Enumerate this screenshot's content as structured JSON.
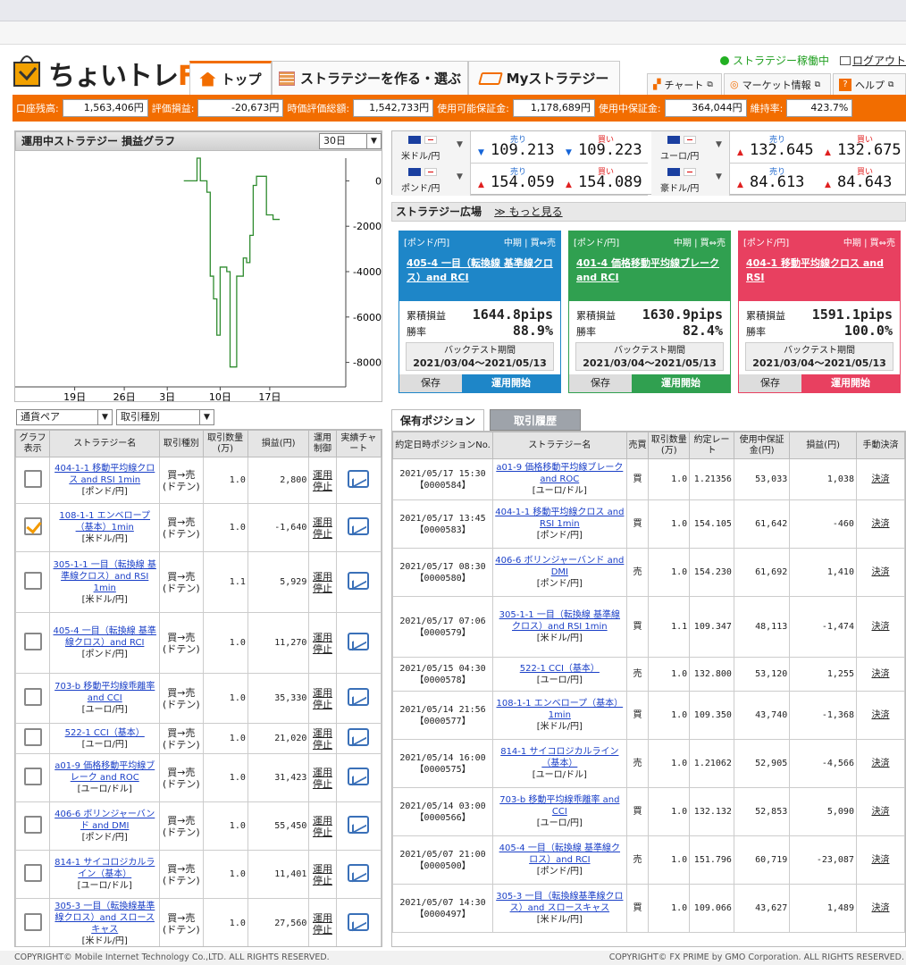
{
  "app": {
    "logo_text": "ちょいトレ",
    "logo_fx": "FX",
    "tabs": [
      {
        "label": "トップ"
      },
      {
        "label": "ストラテジーを作る・選ぶ"
      },
      {
        "label": "Myストラテジー"
      }
    ],
    "status_label": "ストラテジー稼働中",
    "logout_label": "ログアウト",
    "links": [
      {
        "label": "チャート"
      },
      {
        "label": "マーケット情報"
      },
      {
        "label": "ヘルプ"
      }
    ]
  },
  "balance": [
    {
      "label": "口座残高:",
      "value": "1,563,406円"
    },
    {
      "label": "評価損益:",
      "value": "-20,673円"
    },
    {
      "label": "時価評価総額:",
      "value": "1,542,733円"
    },
    {
      "label": "使用可能保証金:",
      "value": "1,178,689円"
    },
    {
      "label": "使用中保証金:",
      "value": "364,044円"
    },
    {
      "label": "維持率:",
      "value": "423.7%"
    }
  ],
  "pl_graph": {
    "title": "運用中ストラテジー 損益グラフ",
    "period": "30日"
  },
  "chart_data": {
    "type": "line",
    "title": "",
    "x_ticks": [
      "19日",
      "26日",
      "3日",
      "10日",
      "17日"
    ],
    "y_ticks": [
      0,
      -2000,
      -4000,
      -6000,
      -8000
    ],
    "ylim": [
      -9000,
      1000
    ],
    "series": [
      {
        "name": "",
        "points": [
          [
            0.51,
            0
          ],
          [
            0.55,
            0
          ],
          [
            0.55,
            1000
          ],
          [
            0.56,
            0
          ],
          [
            0.58,
            -500
          ],
          [
            0.59,
            -4200
          ],
          [
            0.6,
            -5200
          ],
          [
            0.61,
            -6800
          ],
          [
            0.62,
            -3800
          ],
          [
            0.64,
            -4000
          ],
          [
            0.65,
            -8200
          ],
          [
            0.67,
            -4200
          ],
          [
            0.69,
            -3400
          ],
          [
            0.7,
            -3600
          ],
          [
            0.71,
            -2400
          ],
          [
            0.72,
            -200
          ],
          [
            0.73,
            200
          ],
          [
            0.74,
            200
          ],
          [
            0.76,
            -1500
          ],
          [
            0.78,
            -1700
          ],
          [
            0.8,
            -1700
          ]
        ]
      }
    ]
  },
  "rates": [
    {
      "pair": "米ドル/円",
      "bid_label": "売り",
      "ask_label": "買い",
      "bid": "109.213",
      "ask": "109.223",
      "dir": "down"
    },
    {
      "pair": "ユーロ/円",
      "bid_label": "売り",
      "ask_label": "買い",
      "bid": "132.645",
      "ask": "132.675",
      "dir": "up"
    },
    {
      "pair": "ポンド/円",
      "bid_label": "売り",
      "ask_label": "買い",
      "bid": "154.059",
      "ask": "154.089",
      "dir": "up"
    },
    {
      "pair": "豪ドル/円",
      "bid_label": "売り",
      "ask_label": "買い",
      "bid": "84.613",
      "ask": "84.643",
      "dir": "up"
    }
  ],
  "plaza": {
    "title": "ストラテジー広場",
    "more": "もっと見る",
    "cards": [
      {
        "pair": "[ポンド/円]",
        "term": "中期 | 買⇔売",
        "name": "405-4 一目（転換線 基準線クロス）and RCI",
        "pl_label": "累積損益",
        "pl": "1644.8pips",
        "win_label": "勝率",
        "win": "88.9%",
        "bt_label": "バックテスト期間",
        "bt": "2021/03/04～2021/05/13",
        "save": "保存",
        "start": "運用開始",
        "color": "#1e86c8"
      },
      {
        "pair": "[ポンド/円]",
        "term": "中期 | 買⇔売",
        "name": "401-4 価格移動平均線ブレーク and RCI",
        "pl_label": "累積損益",
        "pl": "1630.9pips",
        "win_label": "勝率",
        "win": "82.4%",
        "bt_label": "バックテスト期間",
        "bt": "2021/03/04～2021/05/13",
        "save": "保存",
        "start": "運用開始",
        "color": "#30a050"
      },
      {
        "pair": "[ポンド/円]",
        "term": "中期 | 買⇔売",
        "name": "404-1 移動平均線クロス and RSI",
        "pl_label": "累積損益",
        "pl": "1591.1pips",
        "win_label": "勝率",
        "win": "100.0%",
        "bt_label": "バックテスト期間",
        "bt": "2021/03/04～2021/05/13",
        "save": "保存",
        "start": "運用開始",
        "color": "#e84060"
      }
    ]
  },
  "left_filters": {
    "pair": "通貨ペア",
    "type": "取引種別"
  },
  "left_table": {
    "headers": [
      "グラフ表示",
      "ストラテジー名",
      "取引種別",
      "取引数量(万)",
      "損益(円)",
      "運用制御",
      "実績チャート"
    ],
    "rows": [
      {
        "checked": false,
        "name": "404-1-1 移動平均線クロス and RSI 1min",
        "pair": "[ポンド/円]",
        "type": "買→売(ドテン)",
        "qty": "1.0",
        "pl": "2,800",
        "ctl": "運用停止"
      },
      {
        "checked": true,
        "name": "108-1-1 エンベロープ（基本）1min",
        "pair": "[米ドル/円]",
        "type": "買→売(ドテン)",
        "qty": "1.0",
        "pl": "-1,640",
        "ctl": "運用停止"
      },
      {
        "checked": false,
        "name": "305-1-1 一目（転換線 基準線クロス）and RSI 1min",
        "pair": "[米ドル/円]",
        "type": "買→売(ドテン)",
        "qty": "1.1",
        "pl": "5,929",
        "ctl": "運用停止"
      },
      {
        "checked": false,
        "name": "405-4 一目（転換線 基準線クロス）and RCI",
        "pair": "[ポンド/円]",
        "type": "買→売(ドテン)",
        "qty": "1.0",
        "pl": "11,270",
        "ctl": "運用停止"
      },
      {
        "checked": false,
        "name": "703-b 移動平均線乖離率 and CCI",
        "pair": "[ユーロ/円]",
        "type": "買→売(ドテン)",
        "qty": "1.0",
        "pl": "35,330",
        "ctl": "運用停止"
      },
      {
        "checked": false,
        "name": "522-1 CCI（基本）",
        "pair": "[ユーロ/円]",
        "type": "買→売(ドテン)",
        "qty": "1.0",
        "pl": "21,020",
        "ctl": "運用停止"
      },
      {
        "checked": false,
        "name": "a01-9 価格移動平均線ブレーク and ROC",
        "pair": "[ユーロ/ドル]",
        "type": "買→売(ドテン)",
        "qty": "1.0",
        "pl": "31,423",
        "ctl": "運用停止"
      },
      {
        "checked": false,
        "name": "406-6 ボリンジャーバンド and DMI",
        "pair": "[ポンド/円]",
        "type": "買→売(ドテン)",
        "qty": "1.0",
        "pl": "55,450",
        "ctl": "運用停止"
      },
      {
        "checked": false,
        "name": "814-1 サイコロジカルライン（基本）",
        "pair": "[ユーロ/ドル]",
        "type": "買→売(ドテン)",
        "qty": "1.0",
        "pl": "11,401",
        "ctl": "運用停止"
      },
      {
        "checked": false,
        "name": "305-3 一目（転換線基準線クロス）and スロースキャス",
        "pair": "[米ドル/円]",
        "type": "買→売(ドテン)",
        "qty": "1.0",
        "pl": "27,560",
        "ctl": "運用停止"
      }
    ]
  },
  "pos_tabs": [
    {
      "label": "保有ポジション"
    },
    {
      "label": "取引履歴"
    }
  ],
  "pos_table": {
    "headers": [
      "約定日時ポジションNo.",
      "ストラテジー名",
      "売買",
      "取引数量(万)",
      "約定レート",
      "使用中保証金(円)",
      "損益(円)",
      "手動決済"
    ],
    "rows": [
      {
        "date": "2021/05/17 15:30",
        "no": "【0000584】",
        "name": "a01-9 価格移動平均線ブレーク and ROC",
        "pair": "[ユーロ/ドル]",
        "side": "買",
        "qty": "1.0",
        "rate": "1.21356",
        "margin": "53,033",
        "pl": "1,038",
        "act": "決済"
      },
      {
        "date": "2021/05/17 13:45",
        "no": "【0000583】",
        "name": "404-1-1 移動平均線クロス and RSI 1min",
        "pair": "[ポンド/円]",
        "side": "買",
        "qty": "1.0",
        "rate": "154.105",
        "margin": "61,642",
        "pl": "-460",
        "act": "決済"
      },
      {
        "date": "2021/05/17 08:30",
        "no": "【0000580】",
        "name": "406-6 ボリンジャーバンド and DMI",
        "pair": "[ポンド/円]",
        "side": "売",
        "qty": "1.0",
        "rate": "154.230",
        "margin": "61,692",
        "pl": "1,410",
        "act": "決済"
      },
      {
        "date": "2021/05/17 07:06",
        "no": "【0000579】",
        "name": "305-1-1 一目（転換線 基準線クロス）and RSI 1min",
        "pair": "[米ドル/円]",
        "side": "買",
        "qty": "1.1",
        "rate": "109.347",
        "margin": "48,113",
        "pl": "-1,474",
        "act": "決済"
      },
      {
        "date": "2021/05/15 04:30",
        "no": "【0000578】",
        "name": "522-1 CCI（基本）",
        "pair": "[ユーロ/円]",
        "side": "売",
        "qty": "1.0",
        "rate": "132.800",
        "margin": "53,120",
        "pl": "1,255",
        "act": "決済"
      },
      {
        "date": "2021/05/14 21:56",
        "no": "【0000577】",
        "name": "108-1-1 エンベロープ（基本）1min",
        "pair": "[米ドル/円]",
        "side": "買",
        "qty": "1.0",
        "rate": "109.350",
        "margin": "43,740",
        "pl": "-1,368",
        "act": "決済"
      },
      {
        "date": "2021/05/14 16:00",
        "no": "【0000575】",
        "name": "814-1 サイコロジカルライン（基本）",
        "pair": "[ユーロ/ドル]",
        "side": "売",
        "qty": "1.0",
        "rate": "1.21062",
        "margin": "52,905",
        "pl": "-4,566",
        "act": "決済"
      },
      {
        "date": "2021/05/14 03:00",
        "no": "【0000566】",
        "name": "703-b 移動平均線乖離率 and CCI",
        "pair": "[ユーロ/円]",
        "side": "買",
        "qty": "1.0",
        "rate": "132.132",
        "margin": "52,853",
        "pl": "5,090",
        "act": "決済"
      },
      {
        "date": "2021/05/07 21:00",
        "no": "【0000500】",
        "name": "405-4 一目（転換線 基準線クロス）and RCI",
        "pair": "[ポンド/円]",
        "side": "売",
        "qty": "1.0",
        "rate": "151.796",
        "margin": "60,719",
        "pl": "-23,087",
        "act": "決済"
      },
      {
        "date": "2021/05/07 14:30",
        "no": "【0000497】",
        "name": "305-3 一目（転換線基準線クロス）and スロースキャス",
        "pair": "[米ドル/円]",
        "side": "買",
        "qty": "1.0",
        "rate": "109.066",
        "margin": "43,627",
        "pl": "1,489",
        "act": "決済"
      }
    ]
  },
  "footer": {
    "left": "COPYRIGHT© Mobile Internet Technology Co.,LTD. ALL RIGHTS RESERVED.",
    "right": "COPYRIGHT© FX PRIME by GMO Corporation. ALL RIGHTS RESERVED."
  }
}
